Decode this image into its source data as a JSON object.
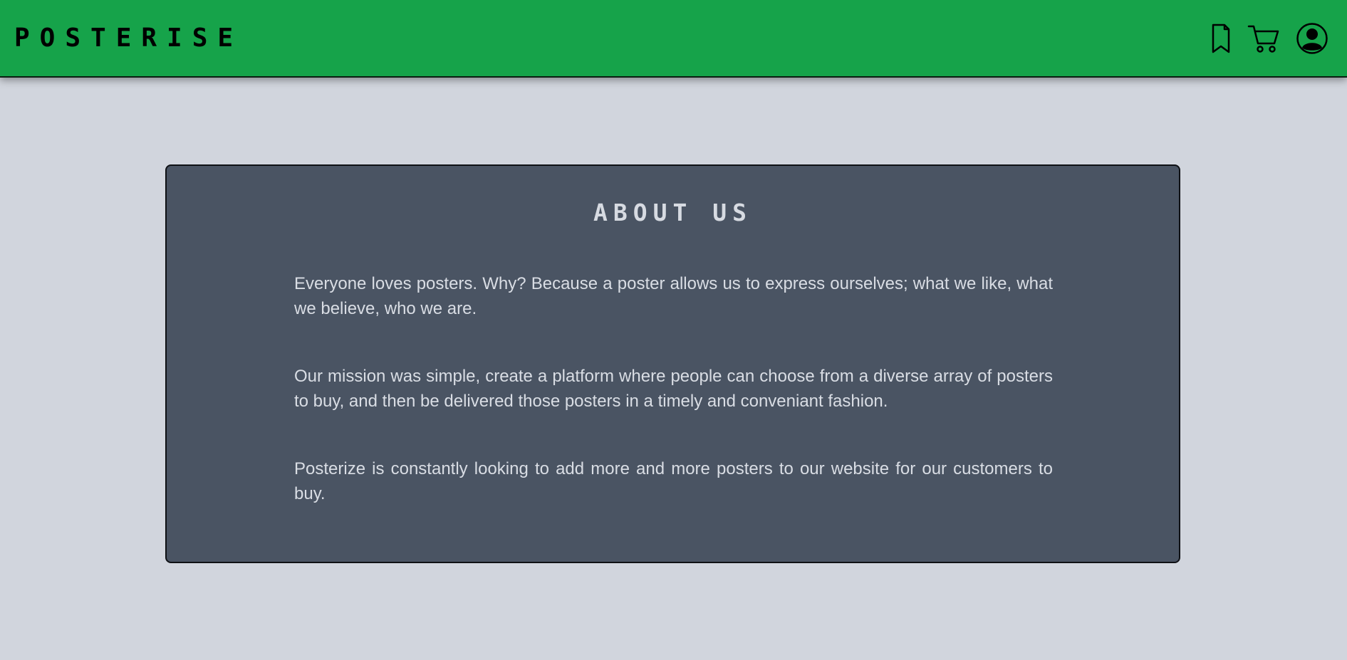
{
  "header": {
    "brand": "POSTERISE",
    "icons": [
      "bookmark-icon",
      "cart-icon",
      "user-icon"
    ]
  },
  "about": {
    "title": "ABOUT US",
    "paragraphs": [
      "Everyone loves posters. Why? Because a poster allows us to express ourselves; what we like, what we believe, who we are.",
      "Our mission was simple, create a platform where people can choose from a diverse array of posters to buy, and then be delivered those posters in a timely and conveniant fashion.",
      "Posterize is constantly looking to add more and more posters to our website for our customers to buy."
    ]
  },
  "colors": {
    "navbar": "#16a34a",
    "page_background": "#d1d5dd",
    "card_background": "#4a5463",
    "card_text": "#d9dde4"
  }
}
